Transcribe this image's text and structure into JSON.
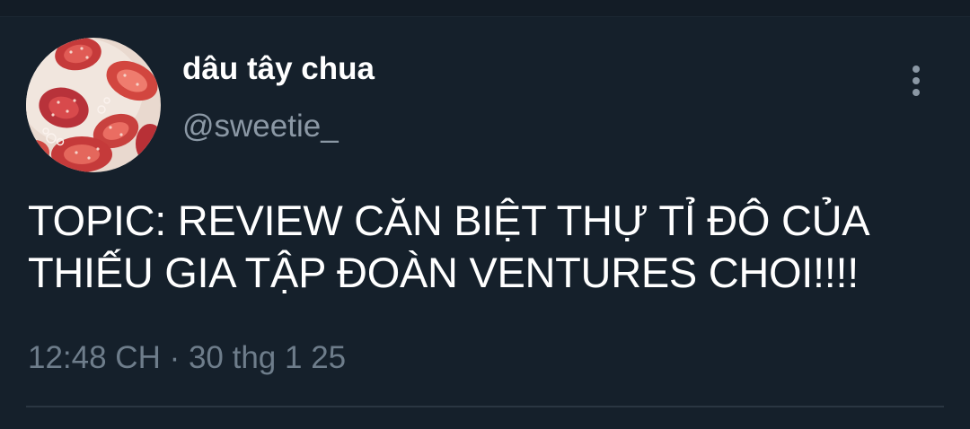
{
  "tweet": {
    "author": {
      "display_name": "dâu tây chua",
      "handle": "@sweetie_",
      "avatar_icon": "strawberry-milk-avatar"
    },
    "menu_icon": "more-vertical-icon",
    "text_lines": [
      "TOPIC: REVIEW CĂN BIỆT THỰ TỈ ĐÔ CỦA",
      "THIẾU GIA TẬP ĐOÀN VENTURES CHOI!!!!"
    ],
    "timestamp": "12:48 CH · 30 thg 1 25"
  },
  "colors": {
    "background": "#15202b",
    "primary_text": "#ffffff",
    "secondary_text": "#8b98a5",
    "divider": "#2a3642"
  }
}
